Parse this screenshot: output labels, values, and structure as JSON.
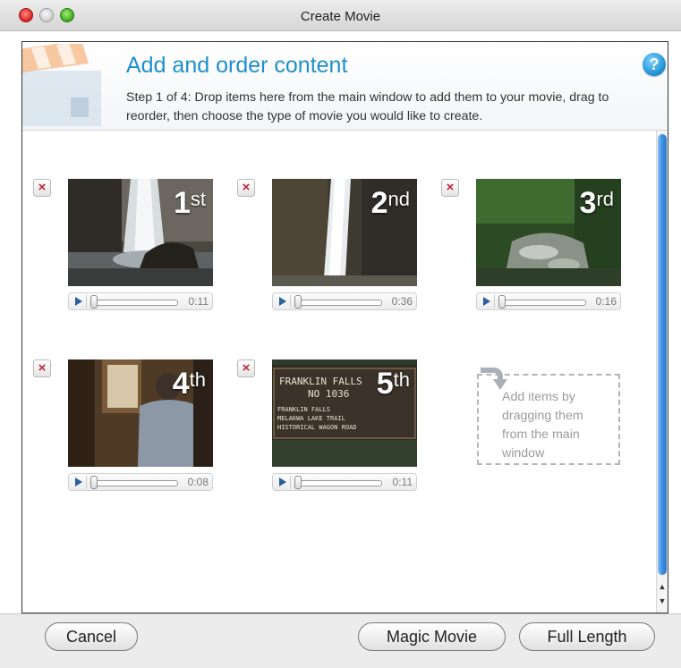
{
  "window": {
    "title": "Create Movie"
  },
  "header": {
    "title": "Add and order content",
    "description": "Step 1 of 4: Drop items here from the main window to add them to your movie, drag to reorder, then choose the type of movie you would like to create.",
    "help_icon": "?"
  },
  "clips": [
    {
      "order_num": "1",
      "order_suffix": "st",
      "duration": "0:11",
      "remove_glyph": "×"
    },
    {
      "order_num": "2",
      "order_suffix": "nd",
      "duration": "0:36",
      "remove_glyph": "×"
    },
    {
      "order_num": "3",
      "order_suffix": "rd",
      "duration": "0:16",
      "remove_glyph": "×"
    },
    {
      "order_num": "4",
      "order_suffix": "th",
      "duration": "0:08",
      "remove_glyph": "×"
    },
    {
      "order_num": "5",
      "order_suffix": "th",
      "duration": "0:11",
      "remove_glyph": "×",
      "sign": {
        "line1": "FRANKLIN FALLS",
        "line2": "NO 1036",
        "line3": "FRANKLIN FALLS",
        "line4": "MELAKWA LAKE TRAIL",
        "line5": "HISTORICAL WAGON ROAD"
      }
    }
  ],
  "drop_zone": {
    "text": "Add items by dragging them from the main window"
  },
  "buttons": {
    "cancel": "Cancel",
    "magic_movie": "Magic Movie",
    "full_length": "Full Length"
  },
  "colors": {
    "accent": "#1f8fcc",
    "remove": "#c0263a",
    "scrollbar": "#3b8fe3"
  }
}
